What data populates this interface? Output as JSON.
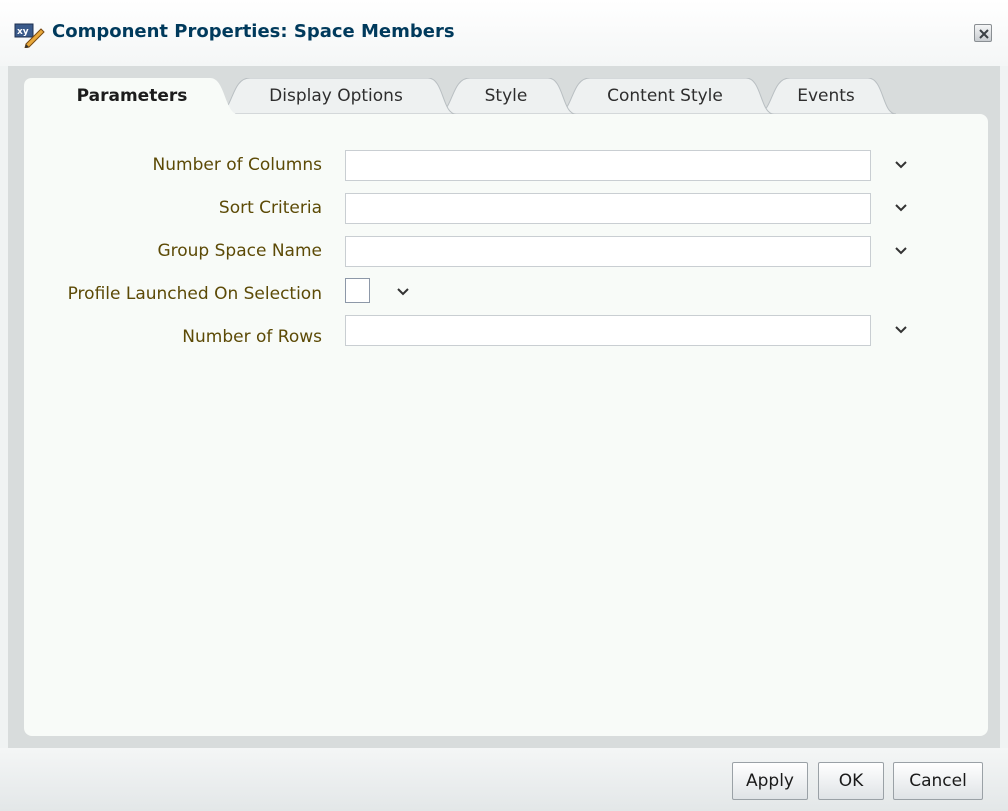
{
  "dialog": {
    "title": "Component Properties: Space Members",
    "icon": "edit-properties-icon",
    "close_icon": "close-icon"
  },
  "tabs": [
    {
      "label": "Parameters",
      "active": true
    },
    {
      "label": "Display Options",
      "active": false
    },
    {
      "label": "Style",
      "active": false
    },
    {
      "label": "Content Style",
      "active": false
    },
    {
      "label": "Events",
      "active": false
    }
  ],
  "parameters": [
    {
      "label": "Number of Columns",
      "value": "",
      "type": "text"
    },
    {
      "label": "Sort Criteria",
      "value": "",
      "type": "text"
    },
    {
      "label": "Group Space Name",
      "value": "",
      "type": "text"
    },
    {
      "label": "Profile Launched On Selection",
      "checked": false,
      "type": "checkbox"
    },
    {
      "label": "Number of Rows",
      "value": "",
      "type": "text"
    }
  ],
  "buttons": {
    "apply": "Apply",
    "ok": "OK",
    "cancel": "Cancel"
  },
  "colors": {
    "title": "#003a5c",
    "label": "#5c4a06",
    "panel_bg": "#f8fbf8"
  }
}
